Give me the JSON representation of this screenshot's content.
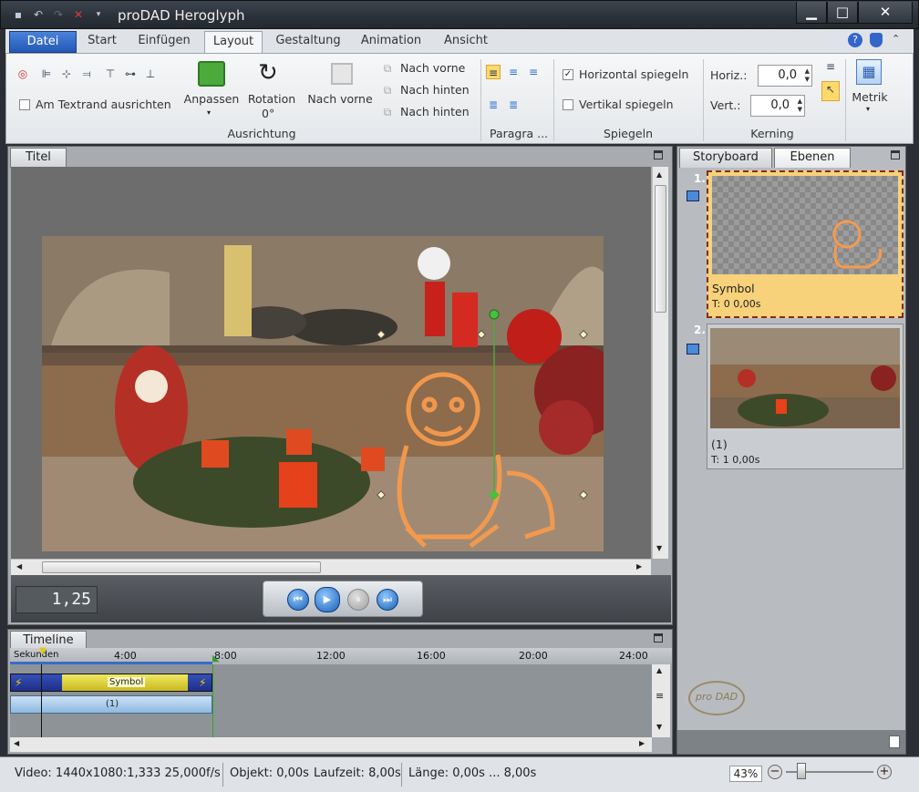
{
  "app": {
    "title": "proDAD Heroglyph"
  },
  "ribbon_tabs": [
    "Datei",
    "Start",
    "Einfügen",
    "Layout",
    "Gestaltung",
    "Animation",
    "Ansicht"
  ],
  "ausrichtung": {
    "am_textrand": "Am Textrand ausrichten",
    "anpassen": "Anpassen",
    "rotation": "Rotation",
    "rotation_value": "0°",
    "nach_vorne_big": "Nach vorne",
    "nach_vorne": "Nach vorne",
    "nach_hinten": "Nach hinten",
    "nach_hinten2": "Nach hinten",
    "label": "Ausrichtung"
  },
  "paragraph": {
    "label": "Paragra ..."
  },
  "spiegeln": {
    "horizontal": "Horizontal spiegeln",
    "vertical": "Vertikal spiegeln",
    "horizontal_checked": true,
    "label": "Spiegeln"
  },
  "kerning": {
    "horiz_label": "Horiz.:",
    "horiz_value": "0,0",
    "vert_label": "Vert.:",
    "vert_value": "0,0",
    "label": "Kerning"
  },
  "metrik": {
    "label": "Metrik"
  },
  "title_pane": {
    "tab": "Titel",
    "timecode": "1,25"
  },
  "timeline": {
    "tab": "Timeline",
    "unit_label": "Sekunden",
    "ticks": [
      "4:00",
      "8:00",
      "12:00",
      "16:00",
      "20:00",
      "24:00"
    ],
    "clip_symbol": "Symbol",
    "clip_bg": "(1)"
  },
  "right_pane": {
    "tabs": [
      "Storyboard",
      "Ebenen"
    ],
    "layers": [
      {
        "index": "1.",
        "name": "Symbol",
        "time": "T: 0  0,00s"
      },
      {
        "index": "2.",
        "name": "(1)",
        "time": "T: 1  0,00s"
      }
    ],
    "logo_text": "pro DAD"
  },
  "status": {
    "video": "Video: 1440x1080:1,333  25,000f/s",
    "objekt": "Objekt: 0,00s",
    "laufzeit": "Laufzeit: 8,00s",
    "laenge": "Länge: 0,00s ... 8,00s",
    "zoom": "43%"
  },
  "colors": {
    "accent_blue": "#2458b7",
    "selection_yellow": "#f7d27a",
    "clip_yellow": "#e8d840"
  }
}
